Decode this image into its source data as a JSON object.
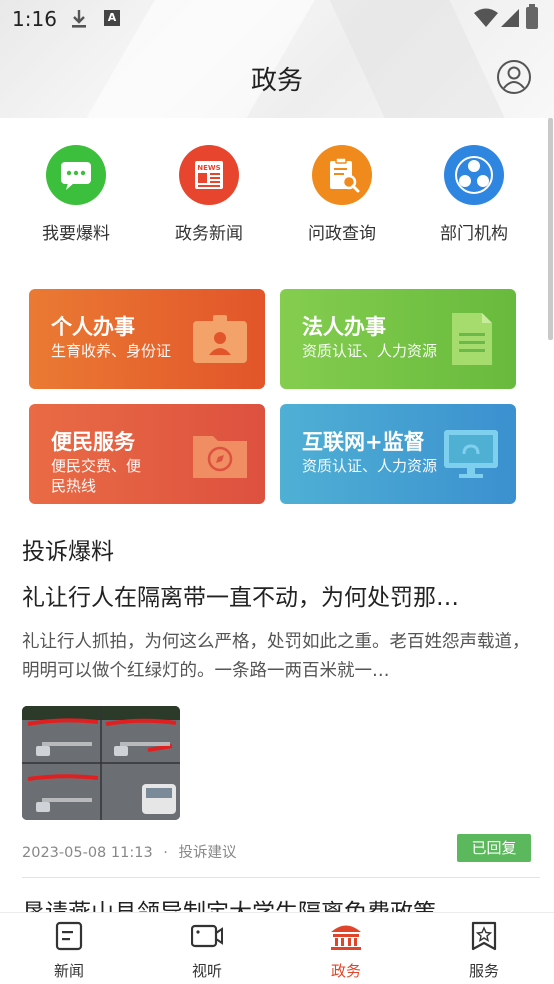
{
  "status_bar": {
    "time": "1:16",
    "a_badge": "A"
  },
  "header": {
    "title": "政务"
  },
  "quick_links": [
    {
      "label": "我要爆料",
      "icon": "chat-bubble-icon",
      "color": "#3cbf3c"
    },
    {
      "label": "政务新闻",
      "icon": "news-icon",
      "color": "#e8452f",
      "badge": "NEWS"
    },
    {
      "label": "问政查询",
      "icon": "query-clipboard-icon",
      "color": "#f08a1c"
    },
    {
      "label": "部门机构",
      "icon": "org-structure-icon",
      "color": "#2f86e0"
    }
  ],
  "cards": [
    {
      "title": "个人办事",
      "subtitle": "生育收养、身份证",
      "icon": "id-card-icon",
      "color": "#e8632a"
    },
    {
      "title": "法人办事",
      "subtitle": "资质认证、人力资源",
      "icon": "document-icon",
      "color": "#7fc84a"
    },
    {
      "title": "便民服务",
      "subtitle": "便民交费、便民热线",
      "icon": "folder-compass-icon",
      "color": "#e3573d"
    },
    {
      "title": "互联网+监督",
      "subtitle": "资质认证、人力资源",
      "icon": "monitor-icon",
      "color": "#3f9dd2"
    }
  ],
  "complaints": {
    "section_title": "投诉爆料",
    "article": {
      "title": "礼让行人在隔离带一直不动，为何处罚那…",
      "body": "礼让行人抓拍，为何这么严格，处罚如此之重。老百姓怨声载道，明明可以做个红绿灯的。一条路一两百米就一…",
      "date": "2023-05-08 11:13",
      "separator": "·",
      "category": "投诉建议",
      "status": "已回复"
    },
    "next_title": "恳请燕山县领导制定大学生隔离免费政策"
  },
  "bottom_nav": [
    {
      "label": "新闻",
      "icon": "news-doc-icon",
      "active": false
    },
    {
      "label": "视听",
      "icon": "video-camera-icon",
      "active": false
    },
    {
      "label": "政务",
      "icon": "government-building-icon",
      "active": true
    },
    {
      "label": "服务",
      "icon": "service-bookmark-icon",
      "active": false
    }
  ],
  "colors": {
    "accent": "#e0452b",
    "replied_badge": "#5cb85c"
  }
}
